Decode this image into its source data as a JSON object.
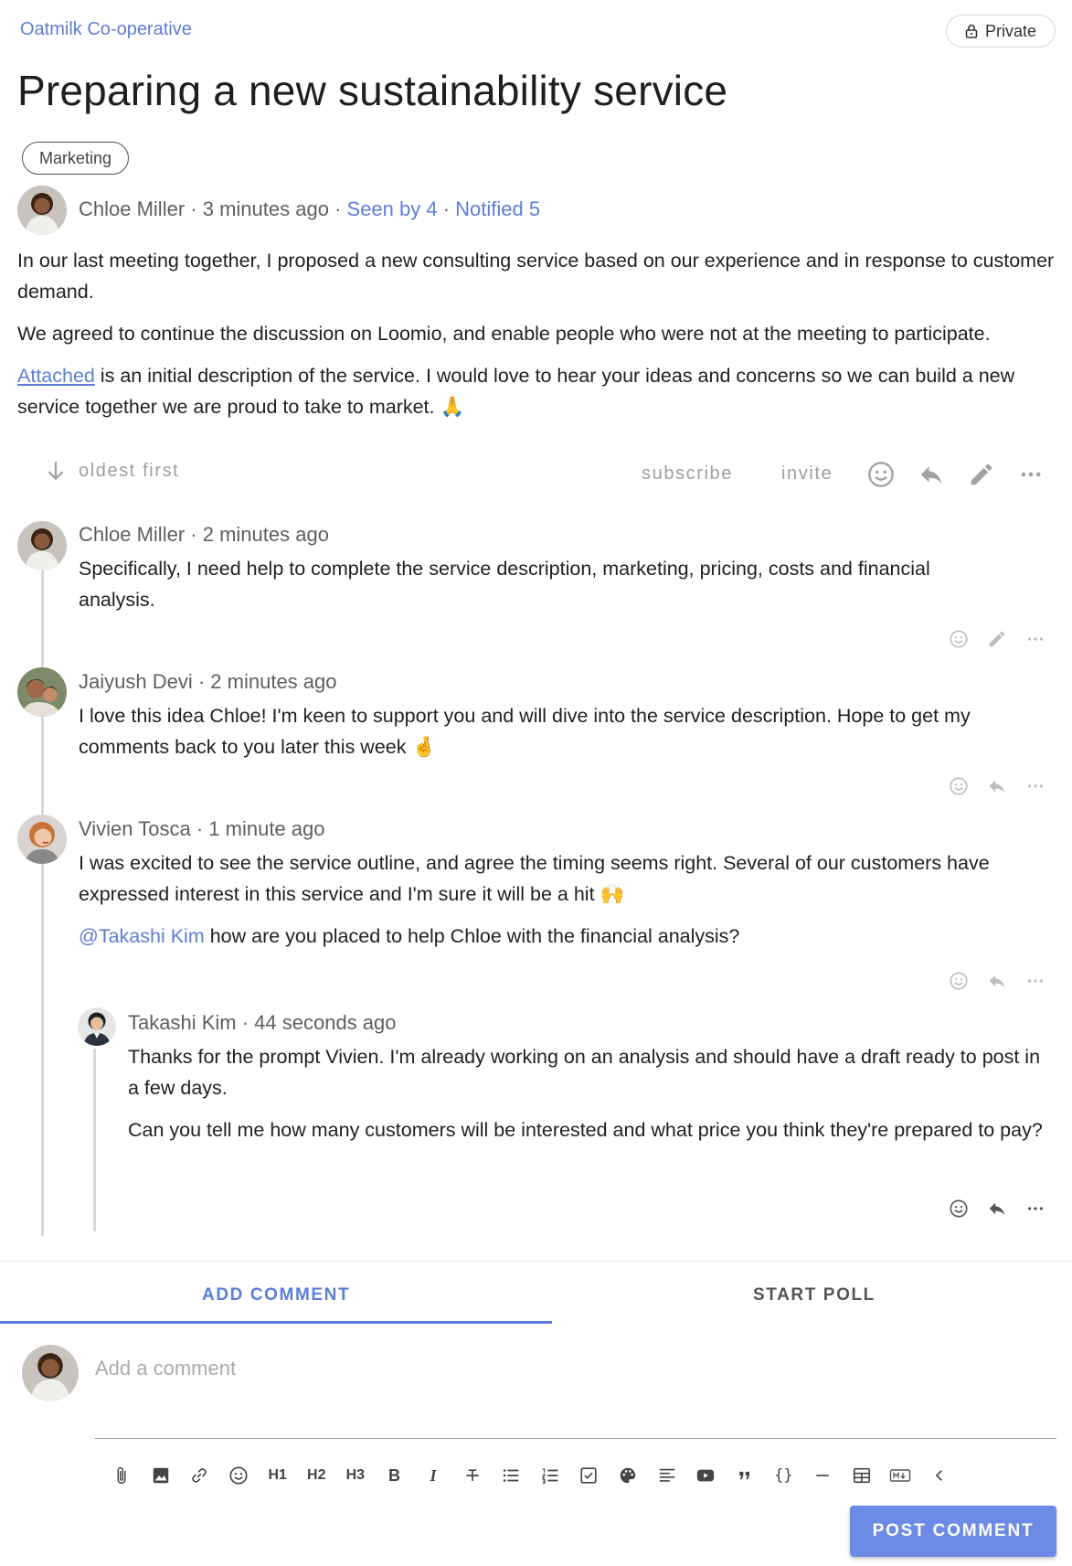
{
  "header": {
    "group_name": "Oatmilk Co-operative",
    "privacy_label": "Private",
    "title": "Preparing a new sustainability service",
    "tag": "Marketing"
  },
  "discussion": {
    "author": "Chloe Miller",
    "sep": "·",
    "time": "3 minutes ago",
    "seen": "Seen by 4",
    "notified": "Notified 5",
    "para1": "In our last meeting together, I proposed a new consulting service based on our experience and in response to customer demand.",
    "para2": "We agreed to continue the discussion on Loomio, and enable people who were not at the meeting to participate.",
    "para3_link": "Attached",
    "para3_rest": " is an initial description of the service. I would love to hear your ideas and concerns so we can build a new service together we are proud to take to market. 🙏"
  },
  "actions_bar": {
    "sort_label": "oldest first",
    "subscribe_label": "subscribe",
    "invite_label": "invite"
  },
  "comments": [
    {
      "author": "Chloe Miller",
      "time": "2 minutes ago",
      "text": "Specifically, I need help to complete the service description, marketing, pricing, costs and financial analysis."
    },
    {
      "author": "Jaiyush Devi",
      "time": "2 minutes ago",
      "text": "I love this idea Chloe! I'm keen to support you and will dive into the service description. Hope to get my comments back to you later this week 🤞"
    },
    {
      "author": "Vivien Tosca",
      "time": "1 minute ago",
      "text": "I was excited to see the service outline, and agree the timing seems right. Several of our customers have expressed interest in this service and I'm sure it will be a hit 🙌",
      "mention": "@Takashi Kim",
      "text2": " how are you placed to help Chloe with the financial analysis?"
    },
    {
      "author": "Takashi Kim",
      "time": "44 seconds ago",
      "text": "Thanks for the prompt Vivien. I'm already working on an analysis and should have a draft ready to post in a few days.",
      "text2": "Can you tell me how many customers will be interested and what price you think they're prepared to pay?"
    }
  ],
  "tabs": {
    "add_comment": "ADD COMMENT",
    "start_poll": "START POLL"
  },
  "composer": {
    "placeholder": "Add a comment",
    "toolbar": [
      "attach-icon",
      "image-icon",
      "link-icon",
      "emoji-icon",
      "H1",
      "H2",
      "H3",
      "B",
      "I",
      "strikethrough-icon",
      "bullet-list-icon",
      "numbered-list-icon",
      "checklist-icon",
      "palette-icon",
      "align-icon",
      "video-icon",
      "quote-icon",
      "{}",
      "horizontal-rule-icon",
      "table-icon",
      "markdown-icon",
      "collapse-icon"
    ],
    "h1": "H1",
    "h2": "H2",
    "h3": "H3",
    "bold": "B",
    "italic": "I",
    "code": "{}",
    "post_label": "POST COMMENT"
  },
  "colors": {
    "accent": "#5b7fd6",
    "button": "#6b8be6",
    "thread_line": "#d7d7d7"
  }
}
